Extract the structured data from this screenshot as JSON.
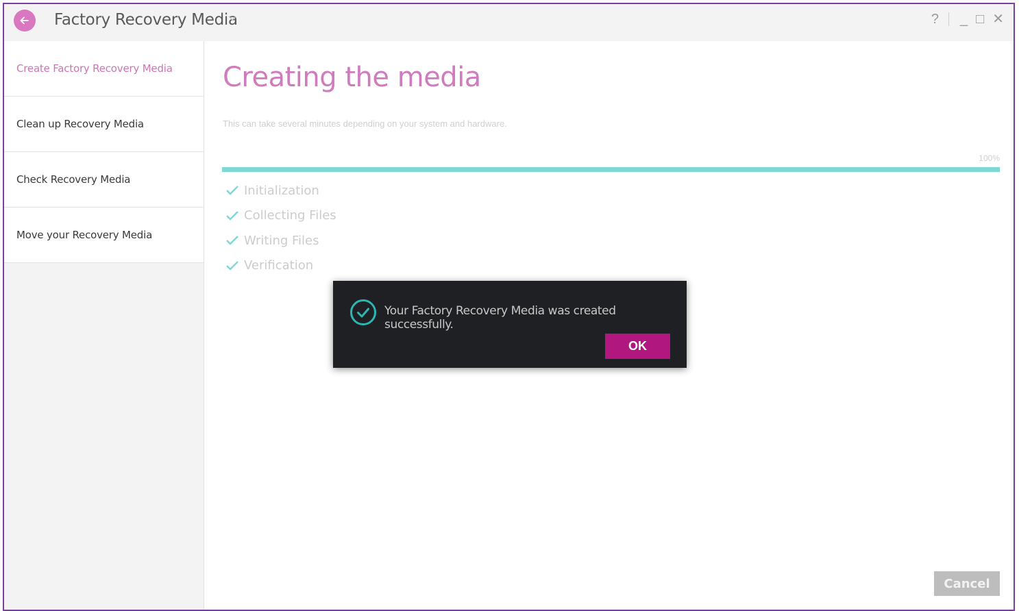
{
  "window": {
    "title": "Factory Recovery Media",
    "controls": {
      "help": "?",
      "minimize": "_",
      "maximize": "□",
      "close": "✕"
    }
  },
  "sidebar": {
    "items": [
      {
        "label": "Create Factory Recovery Media",
        "active": true
      },
      {
        "label": "Clean up Recovery Media",
        "active": false
      },
      {
        "label": "Check Recovery Media",
        "active": false
      },
      {
        "label": "Move your Recovery Media",
        "active": false
      }
    ]
  },
  "main": {
    "title": "Creating the media",
    "subtitle": "This can take several minutes depending on your system and hardware.",
    "progress": {
      "percent_label": "100%",
      "value": 1.0
    },
    "steps": [
      {
        "label": "Initialization",
        "done": true
      },
      {
        "label": "Collecting Files",
        "done": true
      },
      {
        "label": "Writing Files",
        "done": true
      },
      {
        "label": "Verification",
        "done": true
      }
    ],
    "cancel_label": "Cancel"
  },
  "dialog": {
    "message": "Your Factory Recovery Media was created successfully.",
    "ok_label": "OK",
    "icon": "check-circle-icon"
  },
  "colors": {
    "accent": "#d17bbf",
    "progress": "#7fd8d4",
    "ok_button": "#b0187f",
    "dialog_bg": "#1f2023",
    "window_border": "#7b3f9e"
  }
}
